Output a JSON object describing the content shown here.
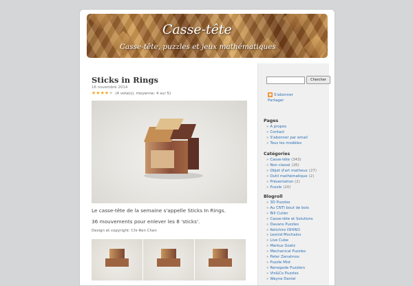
{
  "header": {
    "title": "Casse-tête",
    "description": "Casse-tête, puzzles et jeux mathématiques"
  },
  "post": {
    "title": "Sticks in Rings",
    "date": "16 novembre 2014",
    "rating_text": "(4 vote(s), moyenne: 4 sur 5)",
    "rating_value": 4,
    "rating_max": 5,
    "paragraph1": "Le casse-tête de la semaine s'appelle Sticks In Rings.",
    "paragraph2": "36 mouvements pour enlever les 8 'sticks'.",
    "credit": "Design et copyright: Chi-Ren Chen"
  },
  "sidebar": {
    "search": {
      "value": "",
      "button_label": "Chercher"
    },
    "subscribe_label": "S'abonner",
    "share_label": "Partager",
    "pages": {
      "heading": "Pages",
      "items": [
        "A propos",
        "Contact",
        "S'abonner par email",
        "Tous les modèles"
      ]
    },
    "categories": {
      "heading": "Catégories",
      "items": [
        {
          "label": "Casse-tête",
          "count": "(343)"
        },
        {
          "label": "Non classé",
          "count": "(26)"
        },
        {
          "label": "Objet d'art matheux",
          "count": "(27)"
        },
        {
          "label": "Outil mathématique",
          "count": "(2)"
        },
        {
          "label": "Présentation",
          "count": "(2)"
        },
        {
          "label": "Puzzle",
          "count": "(20)"
        }
      ]
    },
    "blogroll": {
      "heading": "Blogroll",
      "items": [
        "3D Puzzles",
        "Au CNTI bout de bois",
        "Bill Cutler",
        "Casse-tête et Solutions",
        "Davans Puzzles",
        "Keiichiro ISHINO",
        "Leonid Mochalov",
        "Live Cube",
        "Markus Goetz",
        "Mechanical Puzzles",
        "Peter Zenahnov",
        "Puzzle Mist",
        "Renegade Puzzlers",
        "Vin&Co Puzzles",
        "Wayne Daniel"
      ]
    }
  },
  "colors": {
    "page_background": "#d5d6d7",
    "link": "#2a6fb5",
    "star": "#f5a623",
    "rss": "#f28a24"
  }
}
